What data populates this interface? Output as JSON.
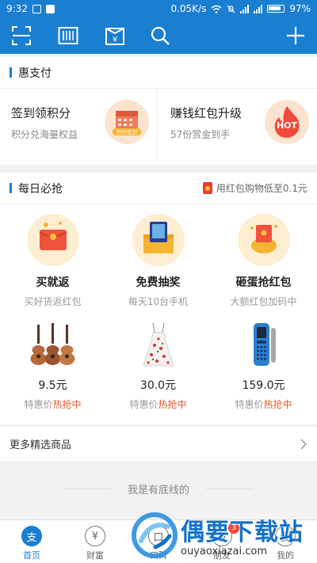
{
  "status_bar": {
    "time": "9:32",
    "network_speed": "0.05K/s",
    "battery": "97%"
  },
  "toolbar": {
    "icons": [
      "scan-icon",
      "barcode-icon",
      "pay-code-icon",
      "search-icon",
      "add-icon"
    ]
  },
  "huizhifu": {
    "title": "惠支付",
    "promos": [
      {
        "title": "签到领积分",
        "subtitle": "积分兑海量权益",
        "badge_text": "积分签到"
      },
      {
        "title": "赚钱红包升级",
        "subtitle": "57份赏金到手",
        "badge_text": "HOT"
      }
    ]
  },
  "daily": {
    "title": "每日必抢",
    "note": "用红包购物低至0.1元",
    "features": [
      {
        "name": "买就返",
        "desc": "买好货返红包"
      },
      {
        "name": "免费抽奖",
        "desc": "每天10台手机"
      },
      {
        "name": "砸蛋抢红包",
        "desc": "大额红包加码中"
      }
    ],
    "products": [
      {
        "price": "9.5元",
        "tag_prefix": "特惠价",
        "tag_hot": "热抢中"
      },
      {
        "price": "30.0元",
        "tag_prefix": "特惠价",
        "tag_hot": "热抢中"
      },
      {
        "price": "159.0元",
        "tag_prefix": "特惠价",
        "tag_hot": "热抢中"
      }
    ]
  },
  "more_link": {
    "label": "更多精选商品"
  },
  "bottom_line": "我是有底线的",
  "tabs": [
    {
      "label": "首页",
      "icon": "支",
      "active": true
    },
    {
      "label": "财富",
      "icon": "¥",
      "active": false
    },
    {
      "label": "口碑",
      "icon": "口",
      "active": false
    },
    {
      "label": "朋友",
      "icon": "友",
      "active": false,
      "badge": "3"
    },
    {
      "label": "我的",
      "icon": "我",
      "active": false
    }
  ],
  "watermark": {
    "name": "偶要下载站",
    "url": "ouyaoxiazai.com"
  },
  "colors": {
    "primary": "#1a7fd1",
    "hot": "#e45a2b"
  }
}
